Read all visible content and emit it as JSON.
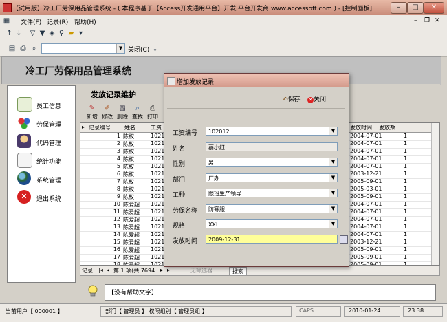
{
  "window": {
    "title": "【试用版】冷工厂劳保用品管理系统 - ( 本程序基于【Access开发通用平台】开发,平台开发商:www.accessoft.com ) - [控制面板]"
  },
  "menu": {
    "items": [
      {
        "label": "文件(F)"
      },
      {
        "label": "记录(R)"
      },
      {
        "label": "帮助(H)"
      }
    ]
  },
  "toolbar2": {
    "close_label": "关闭(C)",
    "search_value": ""
  },
  "header": {
    "title": "冷工厂劳保用品管理系统"
  },
  "sidebar": {
    "items": [
      {
        "label": "员工信息",
        "icon": "certificate-icon"
      },
      {
        "label": "劳保管理",
        "icon": "people-icon"
      },
      {
        "label": "代码管理",
        "icon": "person-icon"
      },
      {
        "label": "统计功能",
        "icon": "chart-icon"
      },
      {
        "label": "系统管理",
        "icon": "globe-icon"
      },
      {
        "label": "退出系统",
        "icon": "exit-icon"
      }
    ]
  },
  "form": {
    "title": "发放记录维护",
    "buttons": [
      {
        "label": "新增",
        "icon": "add-icon"
      },
      {
        "label": "修改",
        "icon": "edit-icon"
      },
      {
        "label": "删除",
        "icon": "delete-icon"
      },
      {
        "label": "查找",
        "icon": "find-icon"
      },
      {
        "label": "打印",
        "icon": "print-icon"
      }
    ],
    "columns": [
      "记录编号",
      "姓名",
      "工资",
      "发放时间",
      "发放数"
    ],
    "rows": [
      {
        "id": "1",
        "name": "陈权",
        "code": "10211",
        "date": "2004-07-01",
        "qty": "1"
      },
      {
        "id": "2",
        "name": "陈权",
        "code": "10211",
        "date": "2004-07-01",
        "qty": "1"
      },
      {
        "id": "3",
        "name": "陈权",
        "code": "10211",
        "date": "2004-07-01",
        "qty": "1"
      },
      {
        "id": "4",
        "name": "陈权",
        "code": "10211",
        "date": "2004-07-01",
        "qty": "1"
      },
      {
        "id": "5",
        "name": "陈权",
        "code": "10211",
        "date": "2004-07-01",
        "qty": "1"
      },
      {
        "id": "6",
        "name": "陈权",
        "code": "10211",
        "date": "2003-12-21",
        "qty": "1"
      },
      {
        "id": "7",
        "name": "陈权",
        "code": "10211",
        "date": "2005-09-01",
        "qty": "1"
      },
      {
        "id": "8",
        "name": "陈权",
        "code": "10211",
        "date": "2005-03-01",
        "qty": "1"
      },
      {
        "id": "9",
        "name": "陈权",
        "code": "10211",
        "date": "2005-09-01",
        "qty": "1"
      },
      {
        "id": "10",
        "name": "陈爱超",
        "code": "10211",
        "date": "2004-07-01",
        "qty": "1"
      },
      {
        "id": "11",
        "name": "陈爱超",
        "code": "10211",
        "date": "2004-07-01",
        "qty": "1"
      },
      {
        "id": "12",
        "name": "陈爱超",
        "code": "10211",
        "date": "2004-07-01",
        "qty": "1"
      },
      {
        "id": "13",
        "name": "陈爱超",
        "code": "10211",
        "date": "2004-07-01",
        "qty": "1"
      },
      {
        "id": "14",
        "name": "陈爱超",
        "code": "10211",
        "date": "2004-07-01",
        "qty": "1"
      },
      {
        "id": "15",
        "name": "陈爱超",
        "code": "10211",
        "date": "2003-12-21",
        "qty": "1"
      },
      {
        "id": "16",
        "name": "陈爱超",
        "code": "10211",
        "date": "2005-09-01",
        "qty": "1"
      },
      {
        "id": "17",
        "name": "陈爱超",
        "code": "10211",
        "date": "2005-09-01",
        "qty": "1"
      },
      {
        "id": "18",
        "name": "陈爱超",
        "code": "10211",
        "date": "2005-09-01",
        "qty": "1"
      }
    ]
  },
  "recnav": {
    "label": "记录:",
    "position": "第 1 项(共 7694",
    "filter": "无筛选器",
    "search": "搜索"
  },
  "help": {
    "text": "【没有帮助文字】"
  },
  "status": {
    "user": "当前用户【 000001 】",
    "dept": "部门【 管理员 】 权限组别【 管理员组 】",
    "caps": "CAPS",
    "date": "2010-01-24",
    "time": "23:38"
  },
  "dialog": {
    "title": "增加发放记录",
    "save_label": "保存",
    "close_label": "关闭",
    "fields": [
      {
        "label": "工资编号",
        "value": "102012"
      },
      {
        "label": "姓名",
        "value": "蔡小红"
      },
      {
        "label": "性别",
        "value": "男"
      },
      {
        "label": "部门",
        "value": "厂办"
      },
      {
        "label": "工种",
        "value": "跟班生产领导"
      },
      {
        "label": "劳保名称",
        "value": "防寒服"
      },
      {
        "label": "规格",
        "value": "XXL"
      },
      {
        "label": "发放时间",
        "value": "2009-12-31"
      }
    ]
  },
  "colors": {
    "titlebar": "#d09a88",
    "highlight_field": "#ffff99"
  }
}
